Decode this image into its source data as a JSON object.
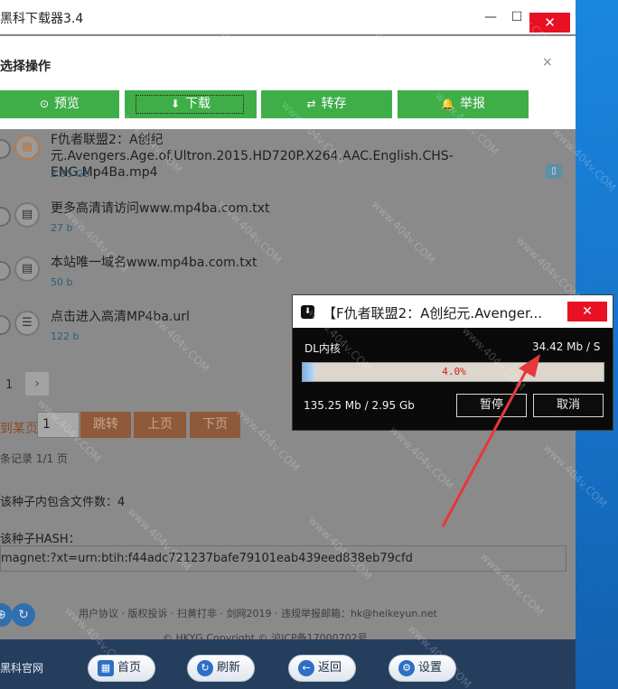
{
  "window": {
    "title": "黑科下载器3.4",
    "min_glyph": "—",
    "max_glyph": "☐",
    "close_glyph": "✕"
  },
  "panel": {
    "title": "选择操作",
    "close_glyph": "×",
    "actions": [
      {
        "label": "预览",
        "icon": "play-circle-icon",
        "glyph": "⊙"
      },
      {
        "label": "下载",
        "icon": "download-icon",
        "glyph": "⬇"
      },
      {
        "label": "转存",
        "icon": "swap-icon",
        "glyph": "⇄"
      },
      {
        "label": "举报",
        "icon": "bell-icon",
        "glyph": "🔔"
      }
    ]
  },
  "files": [
    {
      "name": "F仇者联盟2：A创纪元.Avengers.Age.of.Ultron.2015.HD720P.X264.AAC.English.CHS-ENG.Mp4Ba.mp4",
      "size": "2.95 Gb",
      "icon": "film-icon",
      "glyph": "▦"
    },
    {
      "name": "更多高清请访问www.mp4ba.com.txt",
      "size": "27 b",
      "icon": "book-icon",
      "glyph": "▤"
    },
    {
      "name": "本站唯一域名www.mp4ba.com.txt",
      "size": "50 b",
      "icon": "book-icon",
      "glyph": "▤"
    },
    {
      "name": "点击进入高清MP4ba.url",
      "size": "122 b",
      "icon": "list-icon",
      "glyph": "☰"
    }
  ],
  "mobile_badge_glyph": "▯",
  "pager": {
    "current": "1",
    "next_glyph": "›",
    "jump_label": "到某页",
    "jump_value": "1",
    "jump_button": "跳转",
    "prev_button": "上页",
    "next_button": "下页",
    "records": "条记录 1/1 页"
  },
  "torrent": {
    "file_count_text": "该种子内包含文件数：4",
    "hash_label": "该种子HASH：",
    "hash_value": "magnet:?xt=urn:btih:f44adc721237bafe79101eab439eed838eb79cfd"
  },
  "footer": {
    "links": "用户协议 · 版权投诉 · 扫黄打非 · 剑网2019 · 违规举报邮箱：hk@heikeyun.net",
    "copyright": "© HKYG Copyright © 沪ICP备17000702号"
  },
  "bottombar": {
    "brand": "黑科官网",
    "home": "首页",
    "refresh": "刷新",
    "back": "返回",
    "settings": "设置"
  },
  "dialog": {
    "title": "【F仇者联盟2：A创纪元.Avenger...",
    "close_glyph": "✕",
    "core_label": "DL内核",
    "speed": "34.42 Mb / S",
    "progress_text": "4.0%",
    "progress": 0.04,
    "bytes": "135.25 Mb / 2.95 Gb",
    "pause": "暂停",
    "cancel": "取消"
  },
  "watermark": "www.404v.COM",
  "colors": {
    "green": "#3fae49",
    "brown": "#8e5a3a",
    "navy": "#263e5e",
    "close_red": "#e81123",
    "arrow_red": "#e8373a"
  }
}
